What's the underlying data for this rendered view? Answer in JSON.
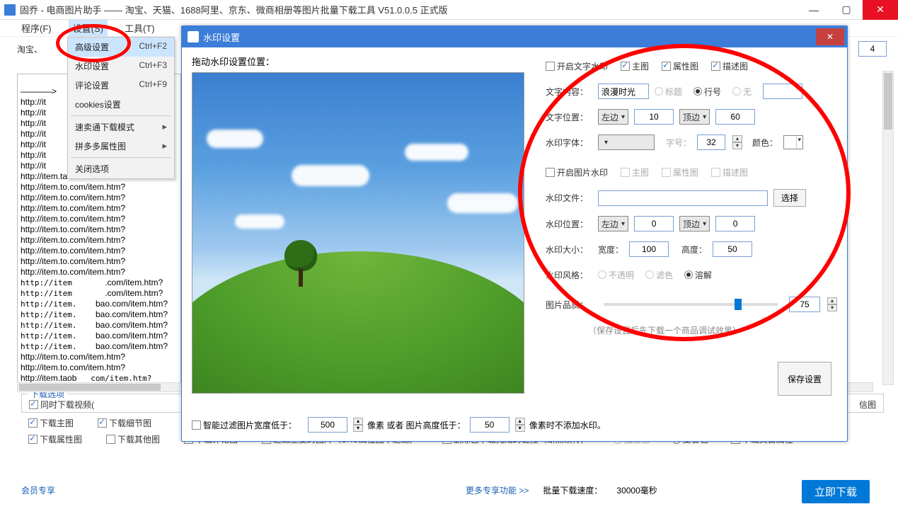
{
  "window": {
    "title": "固乔 - 电商图片助手 —— 淘宝、天猫、1688阿里、京东、微商相册等图片批量下载工具 V51.0.0.5 正式版"
  },
  "menubar": {
    "program": "程序(F)",
    "settings": "设置(S)",
    "tools": "工具(T)"
  },
  "subtitle": "淘宝、",
  "numbox": "4",
  "dropdown": {
    "advanced": "高级设置",
    "advanced_sc": "Ctrl+F2",
    "watermark": "水印设置",
    "watermark_sc": "Ctrl+F3",
    "comments": "评论设置",
    "comments_sc": "Ctrl+F9",
    "cookies": "cookies设置",
    "smt": "速卖通下载模式",
    "pdd": "拼多多属性图",
    "close": "关闭选项"
  },
  "urls": {
    "dash": "————>",
    "short": "http://it",
    "mid": "http://item.taobao.com/item.htm",
    "part_a": "http://item.t",
    "part_b": "o.com/item.htm?",
    "part_c": ".com/item.htm?",
    "part_d": "bao.com/item.htm?",
    "part_e": "http://item.taob"
  },
  "modal": {
    "title": "水印设置",
    "drag": "拖动水印设置位置：",
    "text_wm": "开启文字水印",
    "ck_main": "主图",
    "ck_attr": "属性图",
    "ck_desc": "描述图",
    "content_lab": "文字内容：",
    "content_val": "浪漫时光",
    "r_title": "标题",
    "r_line": "行号",
    "r_none": "无",
    "pos_lab": "文字位置：",
    "sel_left": "左边",
    "pos_x": "10",
    "sel_top": "顶边",
    "pos_y": "60",
    "font_lab": "水印字体：",
    "size_lab": "字号：",
    "size_val": "32",
    "color_lab": "颜色：",
    "img_wm": "开启图片水印",
    "file_lab": "水印文件：",
    "choose": "选择",
    "imgpos_lab": "水印位置：",
    "imgpos_x": "0",
    "imgpos_y": "0",
    "size2_lab": "水印大小：",
    "w_lab": "宽度：",
    "w_val": "100",
    "h_lab": "高度：",
    "h_val": "50",
    "style_lab": "水印风格：",
    "r_opaque": "不透明",
    "r_filter": "滤色",
    "r_dissolve": "溶解",
    "quality_lab": "图片品质：",
    "quality_val": "75",
    "tip": "（保存设置后先下载一个商品调试效果）",
    "save": "保存设置",
    "smart_filter": "智能过滤图片宽度低于：",
    "sf_w": "500",
    "sf_mid": "像素 或者 图片高度低于：",
    "sf_h": "50",
    "sf_end": "像素时不添加水印。"
  },
  "bottom": {
    "dlopts": "下载选项",
    "ck_video": "同时下载视频(",
    "ck_main": "下载主图",
    "ck_detail": "下载细节图",
    "ck_attr": "下载属性图",
    "ck_other": "下载其他图",
    "ck_comment": "下载评论图",
    "ck_filterdup": "过滤重复的图片（SKU属性图不过滤）",
    "ck_removedone": "删除已下载完成的链接（断点续传）",
    "r_single": "独立包",
    "r_compound": "复合包",
    "ck_dlattr": "下载类目属性",
    "info": "信图"
  },
  "more": {
    "member": "会员专享",
    "link": "更多专享功能 >>",
    "speed_lab": "批量下载速度：",
    "speed_val": "30000毫秒",
    "go": "立即下载"
  }
}
